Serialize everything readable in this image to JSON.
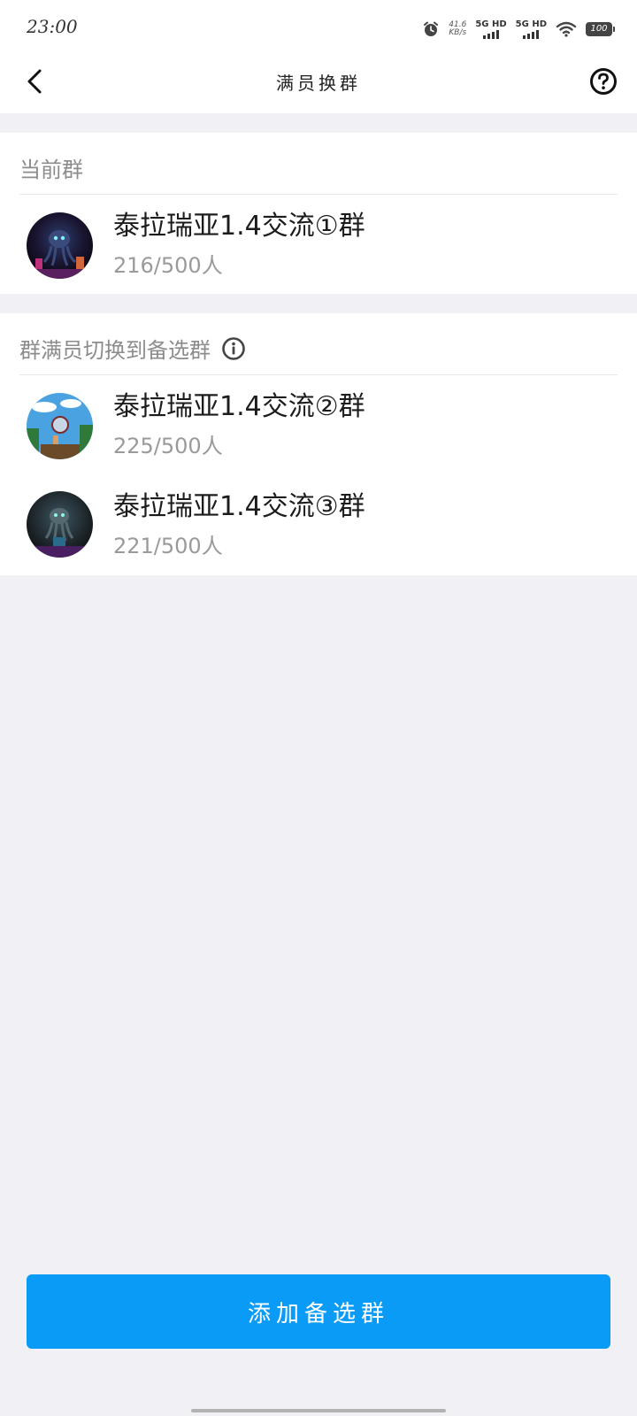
{
  "status_bar": {
    "time": "23:00",
    "net_speed_value": "41.6",
    "net_speed_unit": "KB/s",
    "signal1": "5G HD",
    "signal2": "5G HD",
    "battery": "100",
    "icons": [
      "alarm-icon",
      "wifi-icon",
      "battery-icon"
    ]
  },
  "nav": {
    "title": "满员换群",
    "back_icon": "chevron-left-icon",
    "help_icon": "question-circle-icon"
  },
  "current_section": {
    "header": "当前群",
    "group": {
      "name": "泰拉瑞亚1.4交流①群",
      "count": "216/500人"
    }
  },
  "backup_section": {
    "header": "群满员切换到备选群",
    "info_icon": "info-icon",
    "groups": [
      {
        "name": "泰拉瑞亚1.4交流②群",
        "count": "225/500人"
      },
      {
        "name": "泰拉瑞亚1.4交流③群",
        "count": "221/500人"
      }
    ]
  },
  "footer": {
    "add_button_label": "添加备选群"
  },
  "colors": {
    "accent": "#0a9bf7",
    "background": "#f1f1f5",
    "secondary_text": "#9a9a9a"
  }
}
